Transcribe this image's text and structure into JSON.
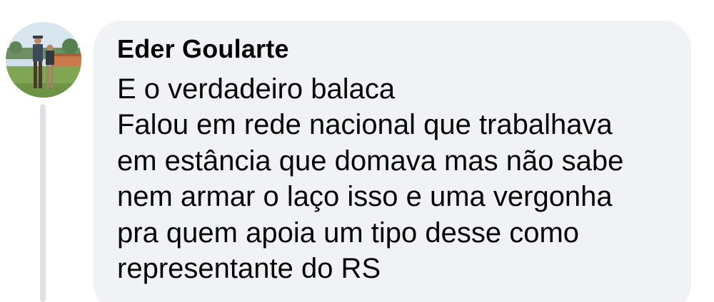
{
  "comment": {
    "author": "Eder Goularte",
    "avatar_icon": "profile-photo",
    "lines": [
      "E o verdadeiro balaca",
      "Falou em rede nacional que trabalhava",
      "em estância que domava mas não sabe",
      "nem armar o laço isso e uma vergonha",
      "pra quem apoia um tipo desse como",
      "representante do RS"
    ]
  },
  "colors": {
    "bubble_background": "#f0f2f5",
    "text": "#050505",
    "thread_line": "#dde1e6"
  }
}
